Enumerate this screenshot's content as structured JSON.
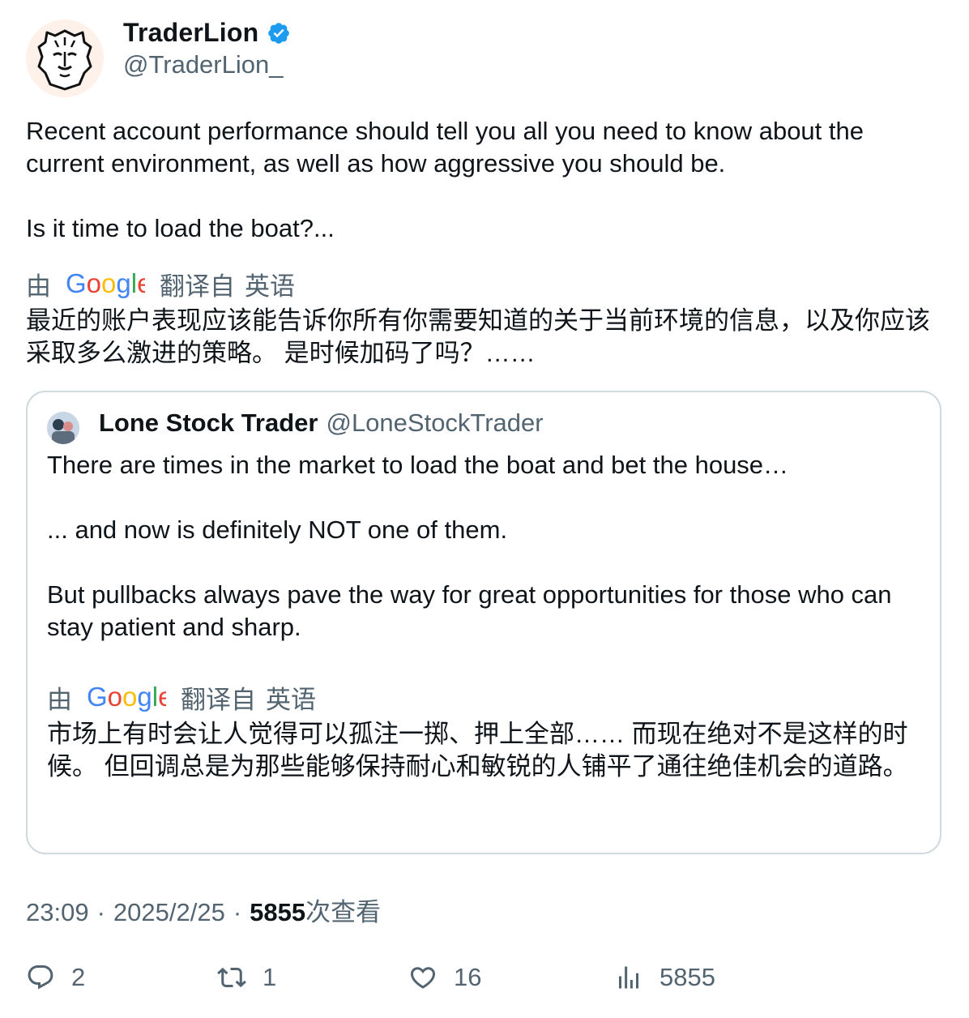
{
  "author": {
    "display_name": "TraderLion",
    "handle": "@TraderLion_",
    "verified_icon": "verified-badge-icon",
    "avatar_icon": "lion-logo"
  },
  "tweet": {
    "text": "Recent account performance should tell you all you need to know about the current environment, as well as how aggressive you should be.\n\nIs it time to load the boat?...",
    "translation_label_prefix": "由",
    "translation_label_suffix": "翻译自",
    "translation_lang": "英语",
    "translation": "最近的账户表现应该能告诉你所有你需要知道的关于当前环境的信息，以及你应该采取多么激进的策略。 是时候加码了吗？……"
  },
  "quote": {
    "display_name": "Lone Stock Trader",
    "handle": "@LoneStockTrader",
    "text": "There are times in the market to load the boat and bet the house…\n\n... and now is definitely NOT one of them.\n\nBut pullbacks always pave the way for great opportunities for those who can stay patient and sharp.",
    "translation_label_prefix": "由",
    "translation_label_suffix": "翻译自",
    "translation_lang": "英语",
    "translation": "市场上有时会让人觉得可以孤注一掷、押上全部…… 而现在绝对不是这样的时候。 但回调总是为那些能够保持耐心和敏锐的人铺平了通往绝佳机会的道路。"
  },
  "meta": {
    "time": "23:09",
    "date": "2025/2/25",
    "separator": "·",
    "views_count": "5855",
    "views_label": "次查看"
  },
  "actions": {
    "replies": "2",
    "retweets": "1",
    "likes": "16",
    "views": "5855"
  },
  "colors": {
    "text": "#0f1419",
    "secondary": "#536471",
    "verified": "#1d9bf0",
    "border": "#cfd9de"
  }
}
